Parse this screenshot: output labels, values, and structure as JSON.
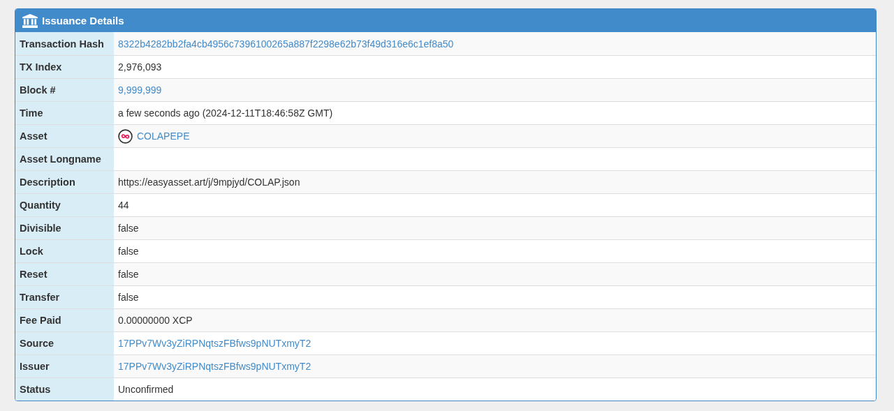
{
  "panel": {
    "title": "Issuance Details"
  },
  "rows": [
    {
      "label": "Transaction Hash",
      "kind": "link",
      "value": "8322b4282bb2fa4cb4956c7396100265a887f2298e62b73f49d316e6c1ef8a50"
    },
    {
      "label": "TX Index",
      "kind": "text",
      "value": "2,976,093"
    },
    {
      "label": "Block #",
      "kind": "link",
      "value": "9,999,999"
    },
    {
      "label": "Time",
      "kind": "text",
      "value": "a few seconds ago (2024-12-11T18:46:58Z GMT)"
    },
    {
      "label": "Asset",
      "kind": "asset",
      "value": "COLAPEPE"
    },
    {
      "label": "Asset Longname",
      "kind": "empty"
    },
    {
      "label": "Description",
      "kind": "text",
      "value": "https://easyasset.art/j/9mpjyd/COLAP.json"
    },
    {
      "label": "Quantity",
      "kind": "text",
      "value": "44"
    },
    {
      "label": "Divisible",
      "kind": "text",
      "value": "false"
    },
    {
      "label": "Lock",
      "kind": "text",
      "value": "false"
    },
    {
      "label": "Reset",
      "kind": "text",
      "value": "false"
    },
    {
      "label": "Transfer",
      "kind": "text",
      "value": "false"
    },
    {
      "label": "Fee Paid",
      "kind": "text",
      "value": "0.00000000 XCP"
    },
    {
      "label": "Source",
      "kind": "link",
      "value": "17PPv7Wv3yZiRPNqtszFBfws9pNUTxmyT2"
    },
    {
      "label": "Issuer",
      "kind": "link",
      "value": "17PPv7Wv3yZiRPNqtszFBfws9pNUTxmyT2"
    },
    {
      "label": "Status",
      "kind": "text",
      "value": "Unconfirmed"
    }
  ]
}
